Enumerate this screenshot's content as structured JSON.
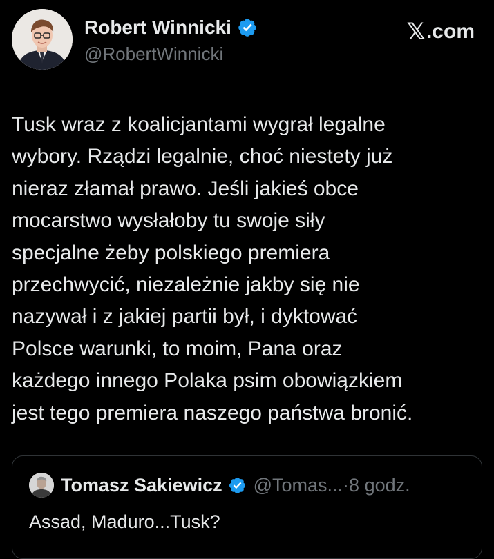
{
  "author": {
    "name": "Robert Winnicki",
    "handle": "@RobertWinnicki",
    "verified": true,
    "badge_color": "#1d9bf0"
  },
  "source": {
    "x_mark": "𝕏",
    "label": ".com"
  },
  "tweet": {
    "lines": [
      "Tusk wraz z koalicjantami wygrał legalne",
      "wybory. Rządzi legalnie, choć niestety już",
      "nieraz złamał prawo. Jeśli jakieś obce",
      "mocarstwo wysłałoby tu swoje siły",
      "specjalne żeby polskiego premiera",
      "przechwycić, niezależnie jakby się nie",
      "nazywał i z jakiej partii był, i dyktować",
      "Polsce warunki, to moim, Pana oraz",
      "każdego innego Polaka psim obowiązkiem",
      "jest tego premiera naszego państwa bronić."
    ]
  },
  "quote": {
    "name": "Tomasz Sakiewicz",
    "handle": "@Tomas...",
    "separator": "·",
    "time": "8 godz.",
    "text": "Assad, Maduro...Tusk?",
    "verified": true
  }
}
